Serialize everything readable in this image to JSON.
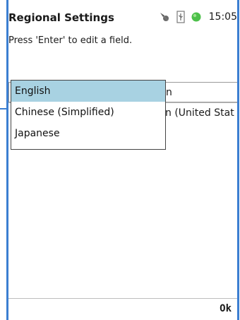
{
  "header": {
    "title": "Regional Settings",
    "time": "15:05",
    "icons": [
      "pin-icon",
      "usb-icon",
      "status-green-icon"
    ]
  },
  "instruction": "Press 'Enter' to edit a field.",
  "fields": [
    {
      "value": "n"
    },
    {
      "value": "n (United Stat"
    }
  ],
  "dropdown": {
    "options": [
      "English",
      "Chinese (Simplified)",
      "Japanese"
    ],
    "selected_index": 0
  },
  "softkey": {
    "ok_label": "Ok"
  },
  "colors": {
    "accent": "#3b7ed1",
    "selection": "#a8d2e2",
    "status_green": "#4cc04a"
  }
}
